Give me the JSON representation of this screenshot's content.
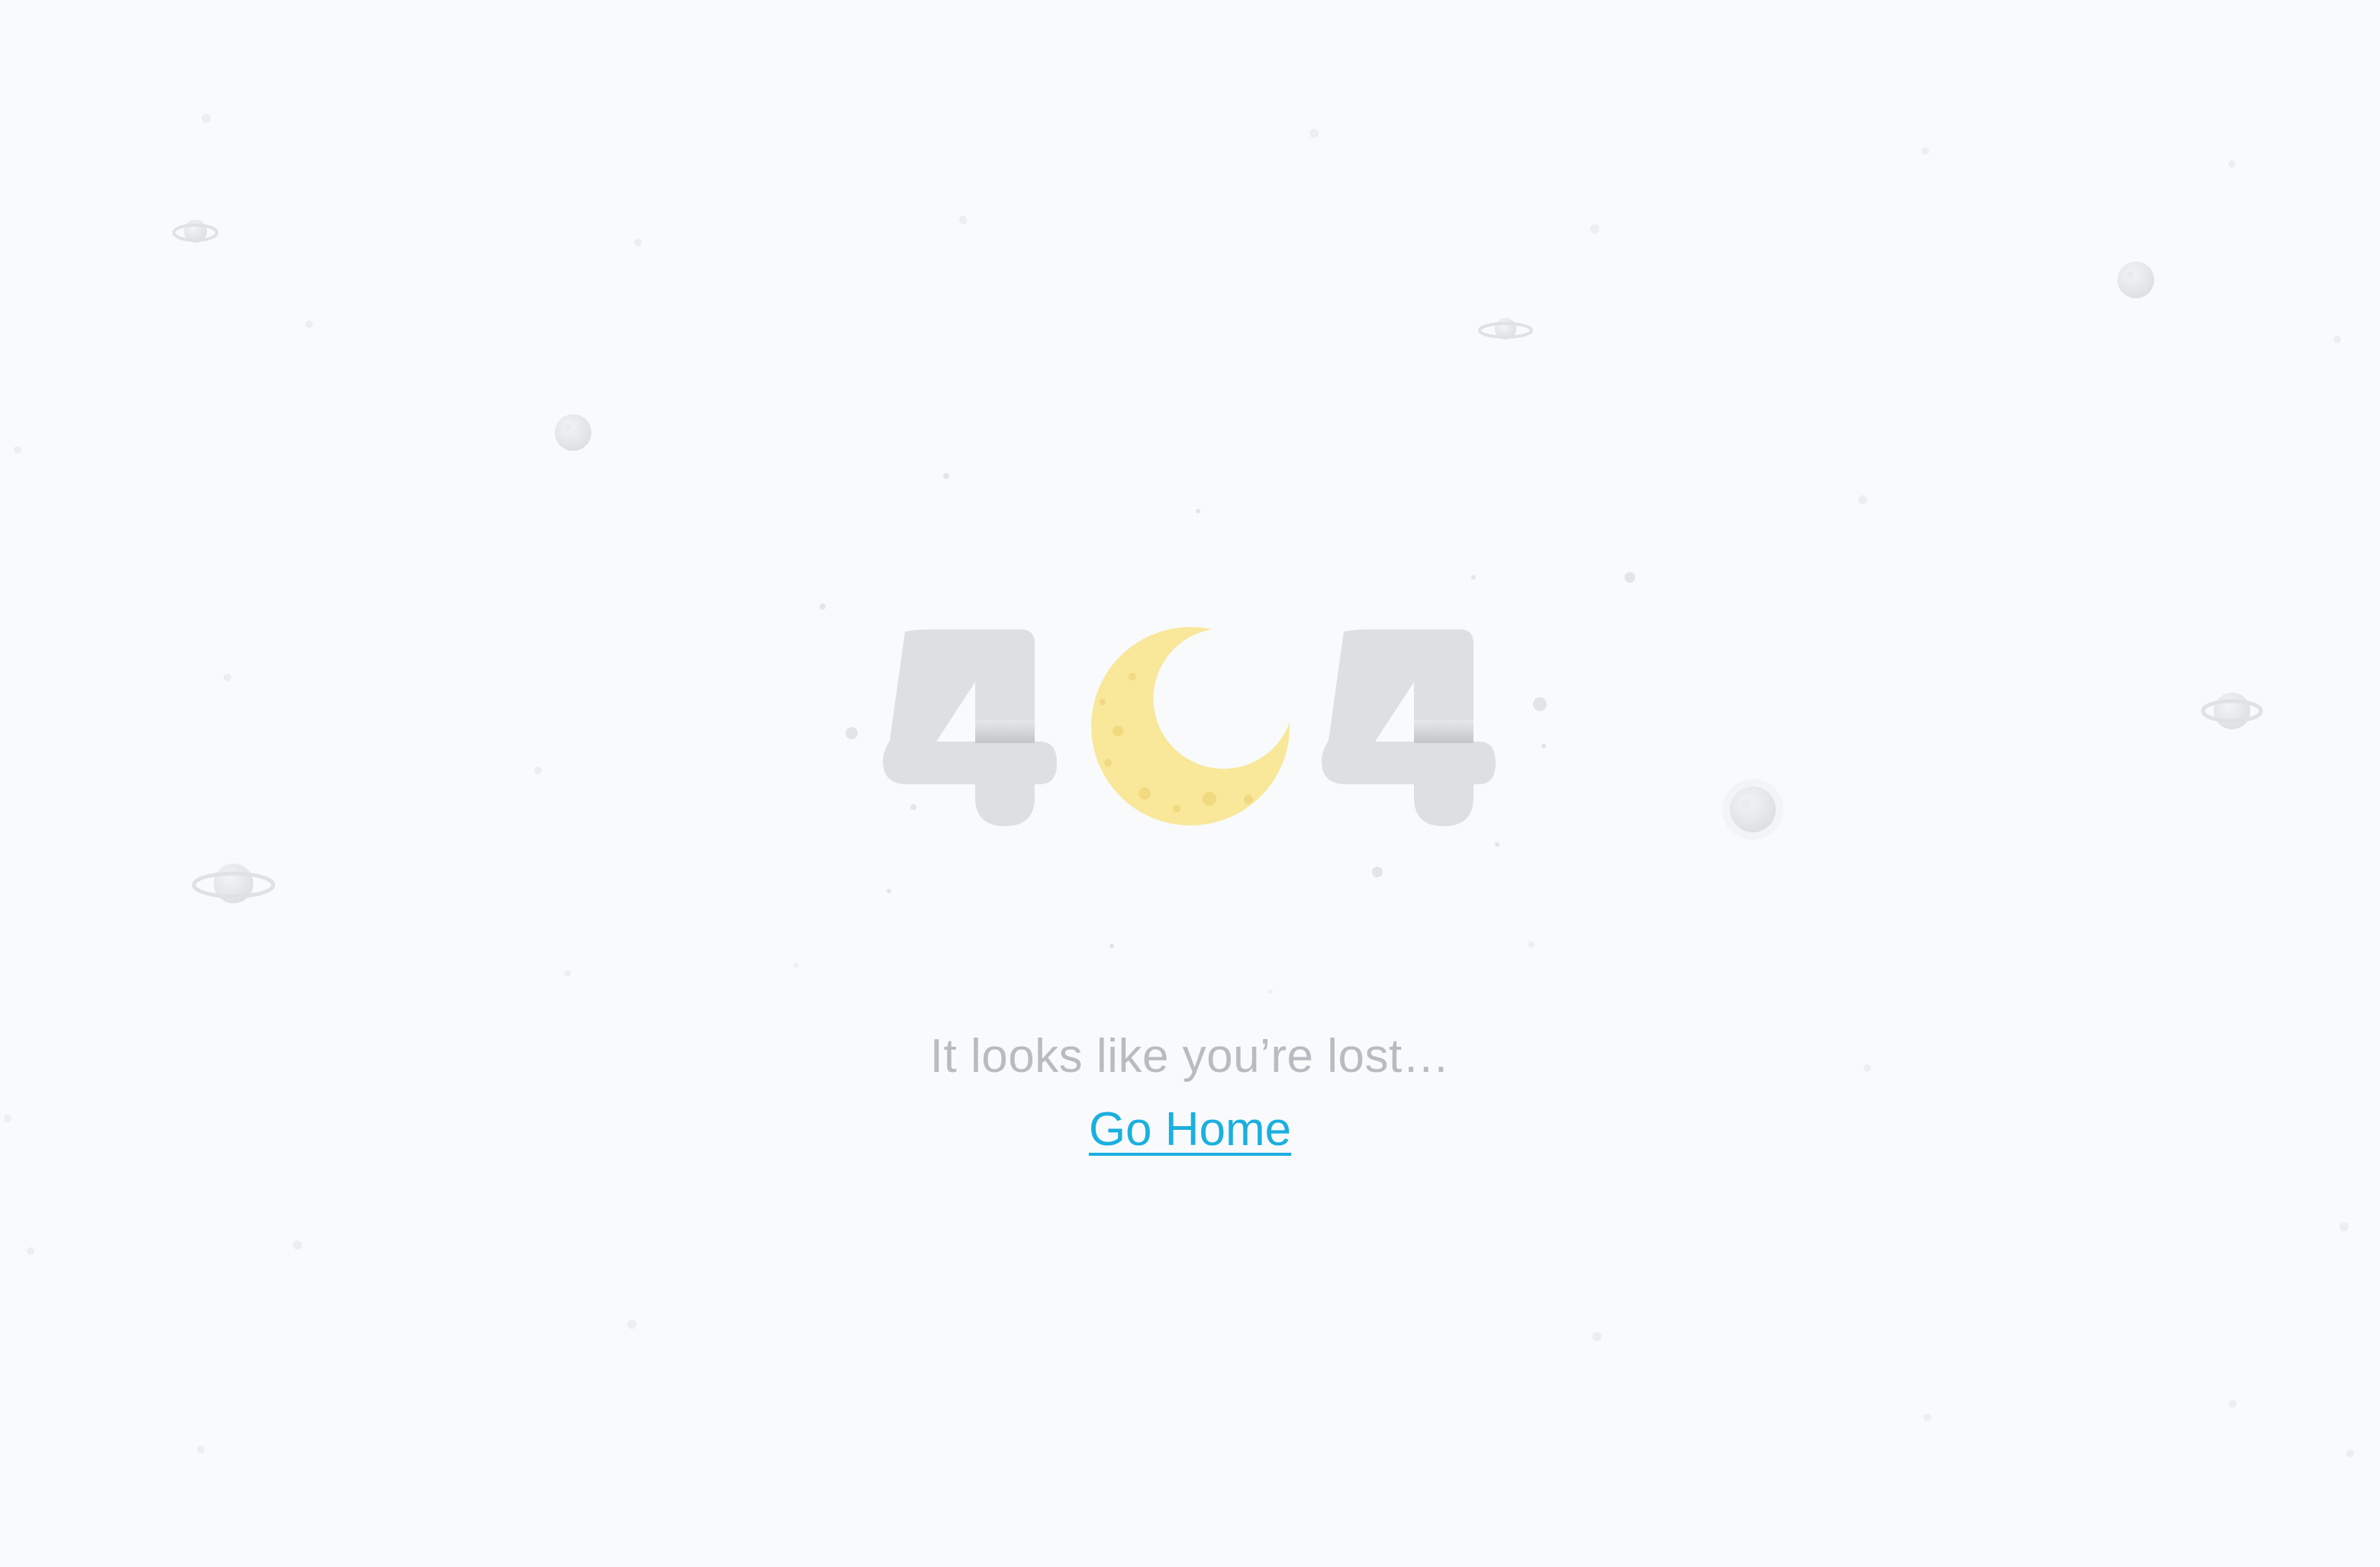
{
  "error": {
    "code_digits": [
      "4",
      "0",
      "4"
    ],
    "message": "It looks like you’re lost…",
    "home_link_label": "Go Home"
  },
  "colors": {
    "background": "#f9fafb",
    "digit": "#dddfe2",
    "moon": "#f9e79a",
    "message": "#b8bbbf",
    "link": "#1aafe0",
    "planet": "#e6e8eb"
  },
  "decorations": {
    "planets": 6,
    "moons": 4
  }
}
